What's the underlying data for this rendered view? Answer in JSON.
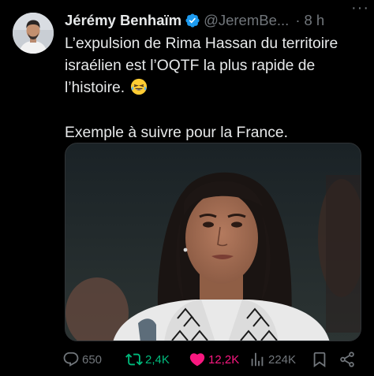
{
  "tweet": {
    "author": {
      "name": "Jérémy Benhaïm",
      "handle": "@JeremBe...",
      "separator": "·",
      "time": "8 h",
      "verified": true,
      "verified_color": "#1d9bf0"
    },
    "more_icon": "more-dots-icon",
    "text_line_1": "L’expulsion de Rima Hassan du territoire israélien est l’OQTF la plus rapide de l’histoire.",
    "emoji": "😂",
    "text_line_2": "Exemple à suivre pour la France.",
    "media": {
      "kind": "photo"
    },
    "actions": {
      "replies": "650",
      "reposts": "2,4K",
      "likes": "12,2K",
      "views": "224K"
    },
    "colors": {
      "background": "#000000",
      "text": "#e7e9ea",
      "muted": "#71767b",
      "repost": "#00ba7c",
      "like": "#f91880"
    }
  }
}
